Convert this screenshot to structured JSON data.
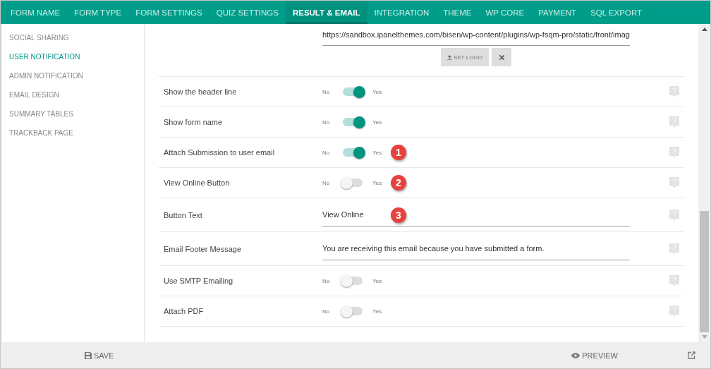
{
  "tabs": [
    {
      "label": "FORM NAME",
      "selected": false
    },
    {
      "label": "FORM TYPE",
      "selected": false
    },
    {
      "label": "FORM SETTINGS",
      "selected": false
    },
    {
      "label": "QUIZ SETTINGS",
      "selected": false
    },
    {
      "label": "RESULT & EMAIL",
      "selected": true
    },
    {
      "label": "INTEGRATION",
      "selected": false
    },
    {
      "label": "THEME",
      "selected": false
    },
    {
      "label": "WP CORE",
      "selected": false
    },
    {
      "label": "PAYMENT",
      "selected": false
    },
    {
      "label": "SQL EXPORT",
      "selected": false
    }
  ],
  "sidebar": {
    "items": [
      {
        "label": "SOCIAL SHARING",
        "selected": false
      },
      {
        "label": "USER NOTIFICATION",
        "selected": true
      },
      {
        "label": "ADMIN NOTIFICATION",
        "selected": false
      },
      {
        "label": "EMAIL DESIGN",
        "selected": false
      },
      {
        "label": "SUMMARY TABLES",
        "selected": false
      },
      {
        "label": "TRACKBACK PAGE",
        "selected": false
      }
    ]
  },
  "logo": {
    "value": "https://sandbox.ipanelthemes.com/bisen/wp-content/plugins/wp-fsqm-pro/static/front/imag",
    "set_button": "SET LOGO"
  },
  "settings": [
    {
      "kind": "toggle",
      "label": "Show the header line",
      "off_label": "No",
      "on_label": "Yes",
      "on": true
    },
    {
      "kind": "toggle",
      "label": "Show form name",
      "off_label": "No",
      "on_label": "Yes",
      "on": true
    },
    {
      "kind": "toggle",
      "label": "Attach Submission to user email",
      "off_label": "No",
      "on_label": "Yes",
      "on": true,
      "marker": "1"
    },
    {
      "kind": "toggle",
      "label": "View Online Button",
      "off_label": "No",
      "on_label": "Yes",
      "on": false,
      "marker": "2"
    },
    {
      "kind": "text",
      "label": "Button Text",
      "value": "View Online",
      "marker": "3"
    },
    {
      "kind": "text",
      "label": "Email Footer Message",
      "value": "You are receiving this email because you have submitted a form."
    },
    {
      "kind": "toggle",
      "label": "Use SMTP Emailing",
      "off_label": "No",
      "on_label": "Yes",
      "on": false
    },
    {
      "kind": "toggle",
      "label": "Attach PDF",
      "off_label": "No",
      "on_label": "Yes",
      "on": false
    }
  ],
  "footer": {
    "save": "SAVE",
    "preview": "PREVIEW"
  }
}
